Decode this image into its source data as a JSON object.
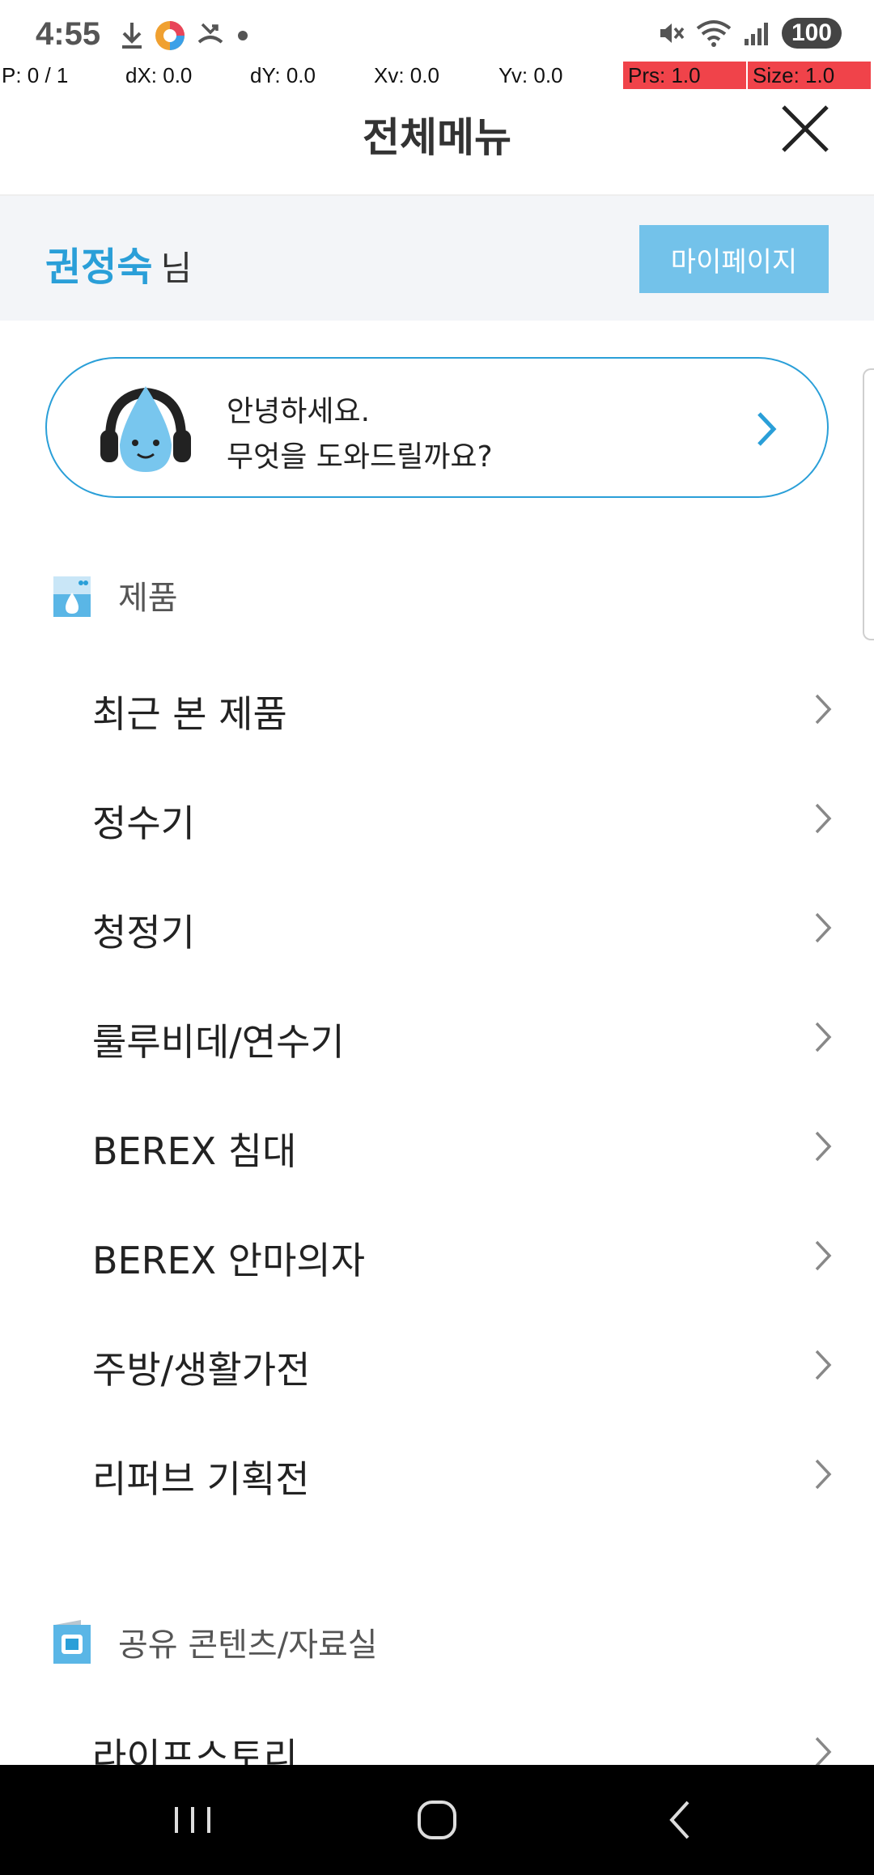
{
  "status_bar": {
    "time": "4:55",
    "battery": "100",
    "icons_left": [
      "download-icon",
      "photos-app-icon",
      "missed-call-icon",
      "dot-icon"
    ],
    "icons_right": [
      "mute-icon",
      "wifi-icon",
      "signal-icon"
    ]
  },
  "debug": {
    "p": "P: 0 / 1",
    "dx": "dX: 0.0",
    "dy": "dY: 0.0",
    "xv": "Xv: 0.0",
    "yv": "Yv: 0.0",
    "prs": "Prs: 1.0",
    "size": "Size: 1.0"
  },
  "header": {
    "title": "전체메뉴",
    "close_icon": "close-icon"
  },
  "user": {
    "name": "권정숙",
    "honorific": "님",
    "mypage_label": "마이페이지"
  },
  "chatbot": {
    "line1": "안녕하세요.",
    "line2": "무엇을 도와드릴까요?"
  },
  "sections": [
    {
      "title": "제품",
      "icon": "product-icon",
      "items": [
        {
          "label": "최근 본 제품"
        },
        {
          "label": "정수기"
        },
        {
          "label": "청정기"
        },
        {
          "label": "룰루비데/연수기"
        },
        {
          "label": "BEREX 침대"
        },
        {
          "label": "BEREX 안마의자"
        },
        {
          "label": "주방/생활가전"
        },
        {
          "label": "리퍼브 기획전"
        }
      ]
    },
    {
      "title": "공유 콘텐츠/자료실",
      "icon": "content-icon",
      "items": [
        {
          "label": "라이프스토리"
        }
      ]
    }
  ],
  "colors": {
    "accent": "#2a9fd8",
    "button": "#73c2ea",
    "user_row_bg": "#f3f5f8",
    "debug_red": "#f0434a"
  }
}
